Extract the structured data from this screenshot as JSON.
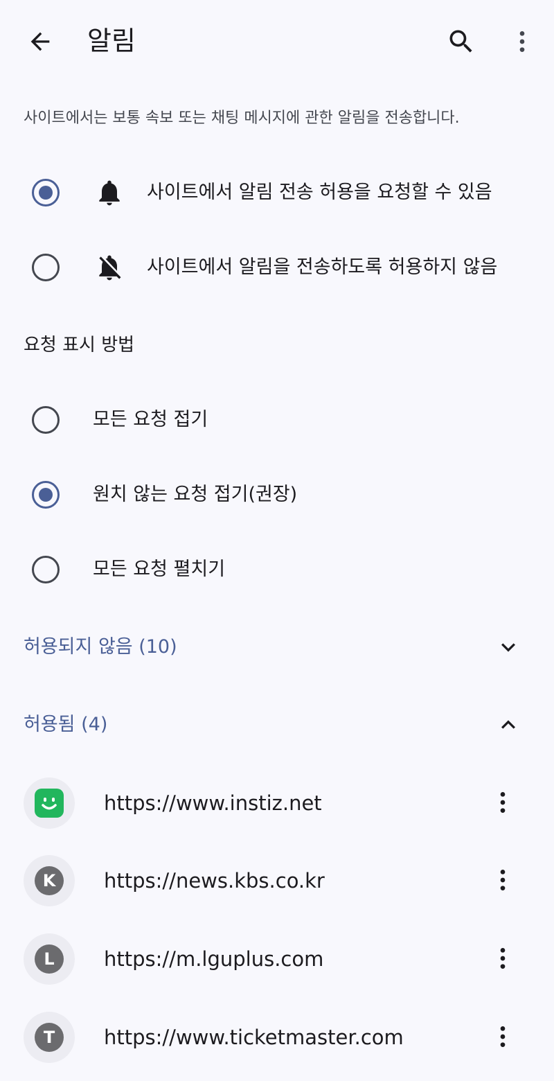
{
  "appbar": {
    "title": "알림",
    "back_icon": "arrow-back-icon",
    "search_icon": "search-icon",
    "more_icon": "more-vert-icon"
  },
  "description": "사이트에서는 보통 속보 또는 채팅 메시지에 관한 알림을 전송합니다.",
  "permission_options": [
    {
      "label": "사이트에서 알림 전송 허용을 요청할 수 있음",
      "icon": "bell-icon",
      "selected": true
    },
    {
      "label": "사이트에서 알림을 전송하도록 허용하지 않음",
      "icon": "bell-off-icon",
      "selected": false
    }
  ],
  "request_display": {
    "heading": "요청 표시 방법",
    "options": [
      {
        "label": "모든 요청 접기",
        "selected": false
      },
      {
        "label": "원치 않는 요청 접기(권장)",
        "selected": true
      },
      {
        "label": "모든 요청 펼치기",
        "selected": false
      }
    ]
  },
  "groups": {
    "blocked": {
      "label": "허용되지 않음 (10)",
      "expanded": false
    },
    "allowed": {
      "label": "허용됨 (4)",
      "expanded": true
    }
  },
  "sites": [
    {
      "url": "https://www.instiz.net",
      "favicon": "instiz-smile-icon"
    },
    {
      "url": "https://news.kbs.co.kr",
      "favicon": "K"
    },
    {
      "url": "https://m.lguplus.com",
      "favicon": "L"
    },
    {
      "url": "https://www.ticketmaster.com",
      "favicon": "T"
    }
  ],
  "colors": {
    "accent": "#4a5f96",
    "background": "#f8f8fd",
    "instiz_green": "#22b65d",
    "favicon_gray": "#6b6b6e"
  }
}
